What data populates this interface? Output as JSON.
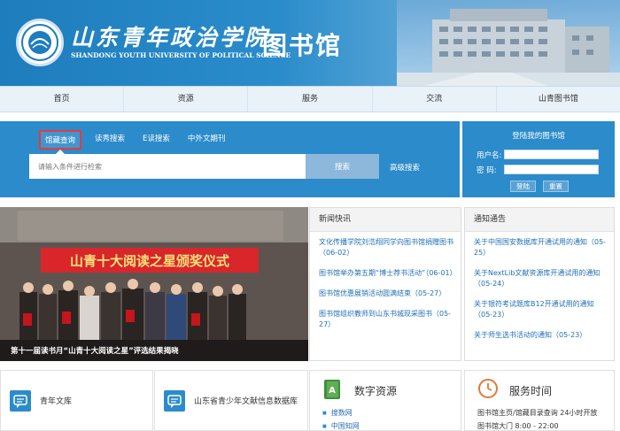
{
  "header": {
    "school_name_cn": "山东青年政治学院",
    "school_name_en": "SHANDONG YOUTH UNIVERSITY OF POLITICAL SCIENCE",
    "library_title": "图书馆"
  },
  "nav": {
    "items": [
      "首页",
      "资源",
      "服务",
      "交流",
      "山青图书馆"
    ]
  },
  "search": {
    "tabs": [
      "馆藏查询",
      "读秀搜索",
      "E读搜索",
      "中外文期刊"
    ],
    "active_tab": "馆藏查询",
    "placeholder": "请输入条件进行检索",
    "button_label": "搜索",
    "advanced_label": "高级搜索"
  },
  "login": {
    "title": "登陆我的图书馆",
    "username_label": "用户名:",
    "password_label": "密  码:",
    "login_button": "登陆",
    "reset_button": "重置"
  },
  "photo": {
    "banner_text": "山青十大阅读之星颁奖仪式",
    "caption": "第十一届读书月“山青十大阅读之星”评选结果揭晓"
  },
  "news": {
    "title": "新闻快讯",
    "items": [
      "文化传播学院刘浩翔同学向图书馆捐赠图书（06-02）",
      "图书馆举办第五期“博士荐书活动”（06-01）",
      "图书馆优惠展销活动圆满结束（05-27）",
      "图书馆组织教师到山东书城现采图书（05-27）"
    ]
  },
  "notices": {
    "title": "通知通告",
    "items": [
      "关于中国国安数据库开通试用的通知（05-25）",
      "关于NextLib文献资源库开通试用的通知（05-24）",
      "关于银符考试题库B12开通试用的通知（05-23）",
      "关于师生选书活动的通知（05-23）"
    ]
  },
  "bottom": {
    "card1_label": "青年文库",
    "card2_label": "山东省青少年文献信息数据库",
    "digital_title": "数字资源",
    "digital_links": [
      "搜数网",
      "中国知网"
    ],
    "service_title": "服务时间",
    "service_lines": [
      "图书馆主页/馆藏目录查询 24小时开放",
      "图书馆大门 8:00 - 22:00"
    ]
  },
  "colors": {
    "primary_blue": "#2c8bcb",
    "nav_bg": "#e9f2f9",
    "link_blue": "#1f6fb5",
    "active_tab_border": "#e53c3c",
    "banner_red": "#d8262b"
  },
  "icons": {
    "card1": "chat-icon",
    "card2": "chat-icon",
    "digital": "book-icon",
    "service": "clock-icon"
  }
}
